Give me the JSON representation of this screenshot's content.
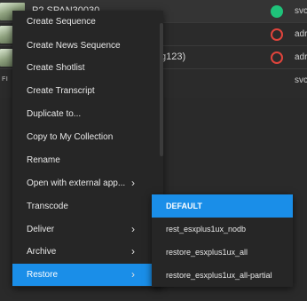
{
  "asset_list": {
    "rows": [
      {
        "thumb_label": "",
        "title": "P2  SPAN30030",
        "partial": "",
        "status": "green",
        "owner": "svc"
      },
      {
        "thumb_label": "",
        "title": "",
        "partial": "",
        "status": "red",
        "owner": "adr"
      },
      {
        "thumb_label": "",
        "title": "",
        "partial": "g123)",
        "status": "red",
        "owner": "adr"
      },
      {
        "thumb_label": "FI",
        "title": "",
        "partial": "",
        "status": "",
        "owner": "svc"
      }
    ],
    "status_colors": {
      "green": "#1fc27a",
      "red": "#e0443c"
    }
  },
  "context_menu": {
    "items": [
      {
        "label": "Create Sequence",
        "has_submenu": false
      },
      {
        "label": "Create News Sequence",
        "has_submenu": false
      },
      {
        "label": "Create Shotlist",
        "has_submenu": false
      },
      {
        "label": "Create Transcript",
        "has_submenu": false
      },
      {
        "label": "Duplicate to...",
        "has_submenu": false
      },
      {
        "label": "Copy to My Collection",
        "has_submenu": false
      },
      {
        "label": "Rename",
        "has_submenu": false
      },
      {
        "label": "Open with external app...",
        "has_submenu": true
      },
      {
        "label": "Transcode",
        "has_submenu": false
      },
      {
        "label": "Deliver",
        "has_submenu": true
      },
      {
        "label": "Archive",
        "has_submenu": true
      },
      {
        "label": "Restore",
        "has_submenu": true,
        "active": true
      }
    ],
    "chevron_glyph": "›",
    "accent": "#1a8ee8"
  },
  "restore_submenu": {
    "items": [
      {
        "label": "DEFAULT",
        "active": true
      },
      {
        "label": "rest_esxplus1ux_nodb"
      },
      {
        "label": "restore_esxplus1ux_all"
      },
      {
        "label": "restore_esxplus1ux_all-partial"
      }
    ]
  }
}
